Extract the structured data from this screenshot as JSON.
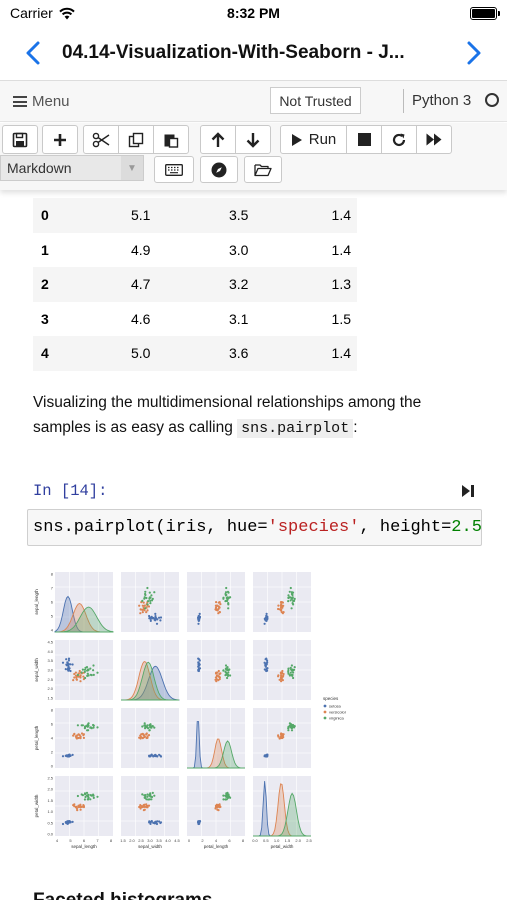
{
  "status_bar": {
    "carrier": "Carrier",
    "time": "8:32 PM"
  },
  "nav": {
    "title": "04.14-Visualization-With-Seaborn - J..."
  },
  "menubar": {
    "menu_label": "Menu",
    "trust_label": "Not Trusted",
    "kernel_name": "Python 3"
  },
  "toolbar": {
    "run_label": "Run",
    "cell_type": "Markdown"
  },
  "dataframe": {
    "rows": [
      [
        "0",
        "5.1",
        "3.5",
        "1.4"
      ],
      [
        "1",
        "4.9",
        "3.0",
        "1.4"
      ],
      [
        "2",
        "4.7",
        "3.2",
        "1.3"
      ],
      [
        "3",
        "4.6",
        "3.1",
        "1.5"
      ],
      [
        "4",
        "5.0",
        "3.6",
        "1.4"
      ]
    ]
  },
  "markdown": {
    "text_before": "Visualizing the multidimensional relationships among the samples is as easy as calling ",
    "code": "sns.pairplot",
    "text_after": ":"
  },
  "code_cell": {
    "prompt": "In [14]:",
    "parts": {
      "p1": "sns.pairplot(iris, hue=",
      "p2": "'species'",
      "p3": ", height=",
      "p4": "2.5"
    }
  },
  "colors": {
    "setosa": "#4c72b0",
    "versicolor": "#dd8452",
    "virginica": "#55a868",
    "panel_bg": "#eaeaf2",
    "prompt": "#303f9f"
  },
  "chart_data": {
    "type": "scatter",
    "variables": [
      "sepal_length",
      "sepal_width",
      "petal_length",
      "petal_width"
    ],
    "hue": "species",
    "legend_title": "species",
    "legend": [
      "setosa",
      "versicolor",
      "virginica"
    ],
    "legend_placement": "right",
    "ticks": {
      "sepal_length": [
        "4",
        "5",
        "6",
        "7",
        "8"
      ],
      "sepal_width": [
        "1.5",
        "2.0",
        "2.5",
        "3.0",
        "3.5",
        "4.0",
        "4.5"
      ],
      "petal_length": [
        "0",
        "2",
        "4",
        "6",
        "8"
      ],
      "petal_width": [
        "0.0",
        "0.5",
        "1.0",
        "1.5",
        "2.0",
        "2.5"
      ]
    },
    "ranges": {
      "sepal_length": [
        4,
        8.5
      ],
      "sepal_width": [
        1.5,
        4.7
      ],
      "petal_length": [
        0,
        8
      ],
      "petal_width": [
        -0.5,
        3.2
      ]
    },
    "species_means": {
      "setosa": [
        5.0,
        3.4,
        1.5,
        0.25
      ],
      "versicolor": [
        5.9,
        2.8,
        4.3,
        1.3
      ],
      "virginica": [
        6.6,
        3.0,
        5.6,
        2.0
      ]
    },
    "species_sd": {
      "setosa": [
        0.35,
        0.38,
        0.17,
        0.1
      ],
      "versicolor": [
        0.5,
        0.31,
        0.47,
        0.2
      ],
      "virginica": [
        0.64,
        0.32,
        0.55,
        0.27
      ]
    }
  },
  "next_section": {
    "heading": "Faceted histograms"
  }
}
